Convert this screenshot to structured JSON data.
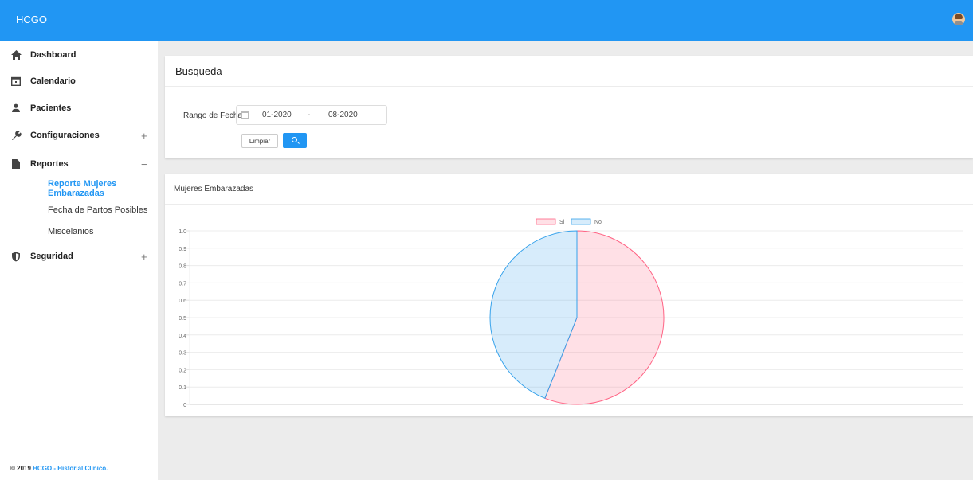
{
  "header": {
    "brand": "HCGO",
    "avatar_icon": "user-avatar"
  },
  "sidebar": {
    "items": [
      {
        "label": "Dashboard",
        "icon": "home-icon"
      },
      {
        "label": "Calendario",
        "icon": "calendar-icon"
      },
      {
        "label": "Pacientes",
        "icon": "person-icon"
      },
      {
        "label": "Configuraciones",
        "icon": "wrench-icon",
        "toggle": "+"
      },
      {
        "label": "Reportes",
        "icon": "document-icon",
        "toggle": "−"
      },
      {
        "label": "Seguridad",
        "icon": "shield-icon",
        "toggle": "+"
      }
    ],
    "subitems": [
      {
        "label": "Reporte Mujeres Embarazadas",
        "active": true
      },
      {
        "label": "Fecha de Partos Posibles"
      },
      {
        "label": "Miscelanios"
      }
    ],
    "footer": {
      "prefix": "© 2019 ",
      "link": "HCGO - Historial Clinico."
    }
  },
  "search": {
    "title": "Busqueda",
    "range_label": "Rango de Fecha",
    "from": "01-2020",
    "separator": "-",
    "to": "08-2020",
    "clear_label": "Limpiar"
  },
  "report": {
    "title": "Mujeres Embarazadas"
  },
  "chart_data": {
    "type": "pie",
    "categories": [
      "Si",
      "No"
    ],
    "values": [
      56,
      44
    ],
    "colors": {
      "Si": "#ff6384",
      "No": "#36a2eb"
    },
    "y_ticks": [
      "1.0",
      "0.9",
      "0.8",
      "0.7",
      "0.6",
      "0.5",
      "0.4",
      "0.3",
      "0.2",
      "0.1",
      "0"
    ],
    "legend": "top",
    "grid": true
  },
  "colors": {
    "primary": "#2196f3",
    "background": "#ececec"
  }
}
